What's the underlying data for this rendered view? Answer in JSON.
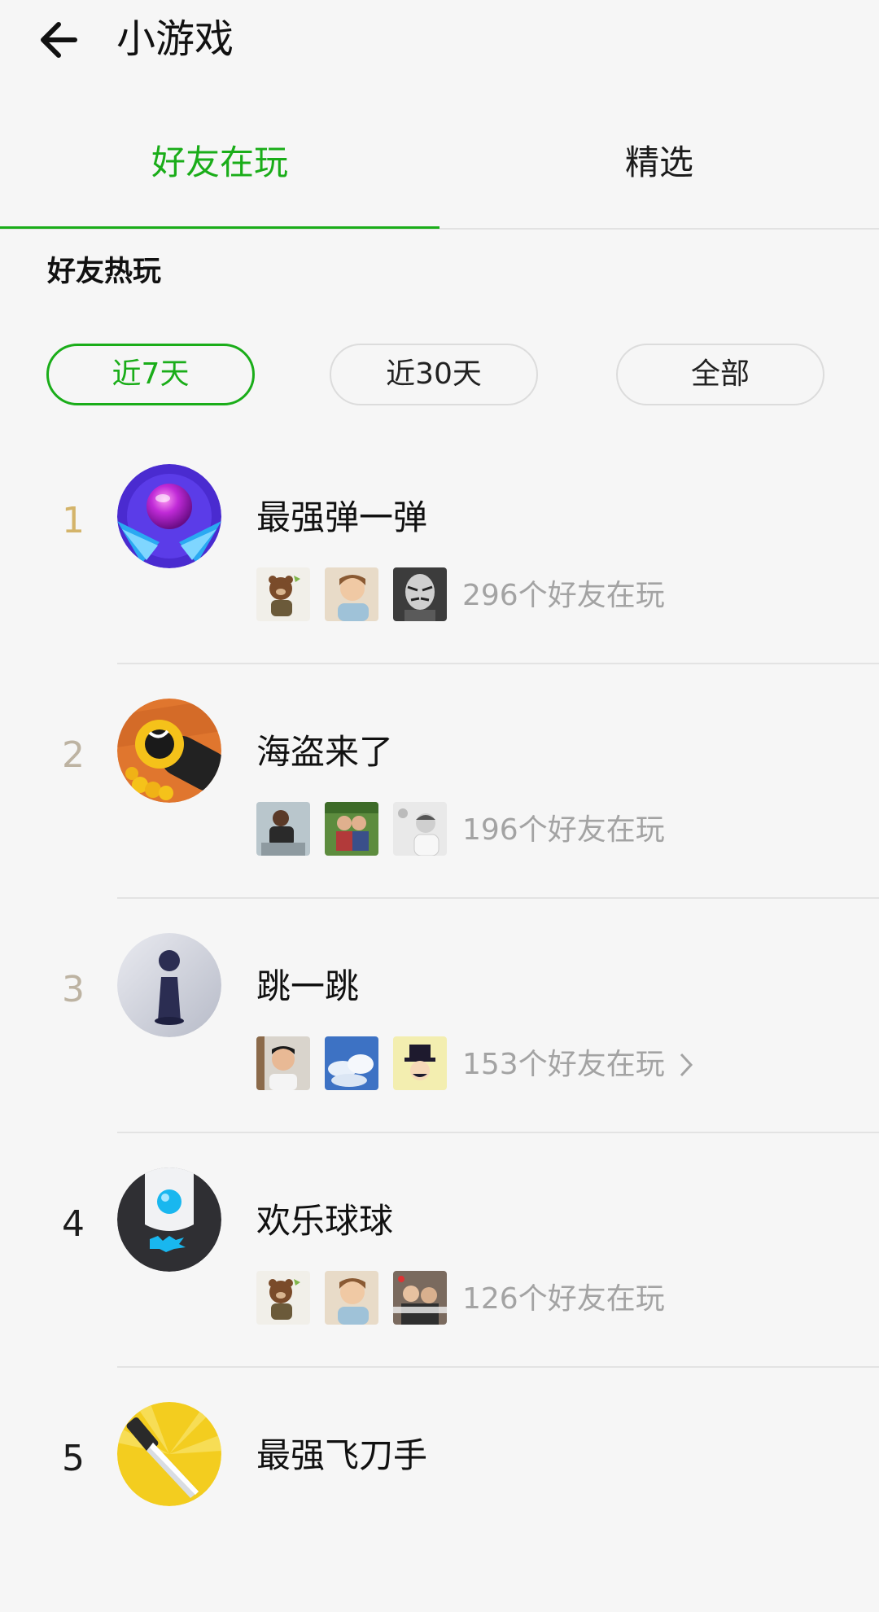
{
  "header": {
    "title": "小游戏",
    "back_icon": "arrow-left-icon"
  },
  "tabs": [
    {
      "label": "好友在玩",
      "active": true
    },
    {
      "label": "精选",
      "active": false
    }
  ],
  "section": {
    "title": "好友热玩"
  },
  "filters": [
    {
      "label": "近7天",
      "active": true
    },
    {
      "label": "近30天",
      "active": false
    },
    {
      "label": "全部",
      "active": false
    }
  ],
  "colors": {
    "accent": "#1aad19",
    "muted": "#a3a3a3",
    "rank_top": "#d4b46a",
    "rank_mid": "#bdb3a2",
    "rank_plain": "#1b1b1b"
  },
  "games": [
    {
      "rank": "1",
      "name": "最强弹一弹",
      "friends": "296个好友在玩",
      "has_chevron": false,
      "icon": "purple-ball-icon"
    },
    {
      "rank": "2",
      "name": "海盗来了",
      "friends": "196个好友在玩",
      "has_chevron": false,
      "icon": "pirate-cannon-icon"
    },
    {
      "rank": "3",
      "name": "跳一跳",
      "friends": "153个好友在玩",
      "has_chevron": true,
      "icon": "jump-piece-icon"
    },
    {
      "rank": "4",
      "name": "欢乐球球",
      "friends": "126个好友在玩",
      "has_chevron": false,
      "icon": "blue-ball-icon"
    },
    {
      "rank": "5",
      "name": "最强飞刀手",
      "friends": "",
      "has_chevron": false,
      "icon": "knife-icon"
    }
  ]
}
